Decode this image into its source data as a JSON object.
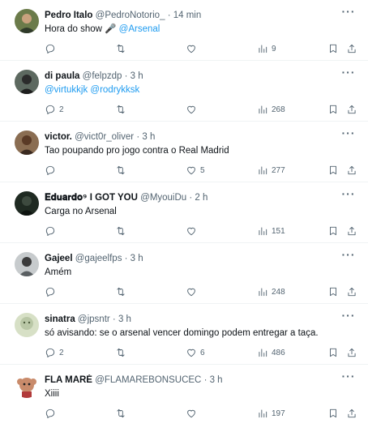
{
  "tweets": [
    {
      "name": "Pedro Italo",
      "handle": "@PedroNotorio_",
      "time": "· 14 min",
      "text_plain": "Hora do show 🎤 ",
      "text_mention": "@Arsenal",
      "replies": "",
      "retweets": "",
      "likes": "",
      "views": "9",
      "avatar_color": "#6b7b4a"
    },
    {
      "name": "di paula",
      "handle": "@felpzdp",
      "time": "· 3 h",
      "text_plain": "",
      "text_mention": "@virtukkjk @rodrykksk",
      "replies": "2",
      "retweets": "",
      "likes": "",
      "views": "268",
      "avatar_color": "#3a3f3a"
    },
    {
      "name": "victor.",
      "handle": "@vict0r_oliver",
      "time": "· 3 h",
      "text_plain": "Tao poupando pro jogo contra o Real Madrid",
      "text_mention": "",
      "replies": "",
      "retweets": "",
      "likes": "5",
      "views": "277",
      "avatar_color": "#6d4a36"
    },
    {
      "name": "𝐄𝐝𝐮𝐚𝐫𝐝𝐨⁹ I GOT YOU",
      "handle": "@MyouiDu",
      "time": "· 2 h",
      "text_plain": "Carga no Arsenal",
      "text_mention": "",
      "replies": "",
      "retweets": "",
      "likes": "",
      "views": "151",
      "avatar_color": "#1f2a22"
    },
    {
      "name": "Gajeel",
      "handle": "@gajeelfps",
      "time": "· 3 h",
      "text_plain": "Amém",
      "text_mention": "",
      "replies": "",
      "retweets": "",
      "likes": "",
      "views": "248",
      "avatar_color": "#8a8f92"
    },
    {
      "name": "sinatra",
      "handle": "@jpsntr",
      "time": "· 3 h",
      "text_plain": "só avisando: se o arsenal vencer domingo podem entregar a taça.",
      "text_mention": "",
      "replies": "2",
      "retweets": "",
      "likes": "6",
      "views": "486",
      "avatar_color": "#b9c7a6"
    },
    {
      "name": "FLA MARÉ",
      "handle": "@FLAMAREBONSUCEC",
      "time": "· 3 h",
      "text_plain": "Xiiii",
      "text_mention": "",
      "replies": "",
      "retweets": "",
      "likes": "",
      "views": "197",
      "avatar_color": "#b13a3a"
    }
  ],
  "icons": {
    "reply": "reply-icon",
    "retweet": "retweet-icon",
    "like": "heart-icon",
    "views": "views-chart-icon",
    "bookmark": "bookmark-icon",
    "share": "share-icon",
    "more": "more-icon"
  }
}
